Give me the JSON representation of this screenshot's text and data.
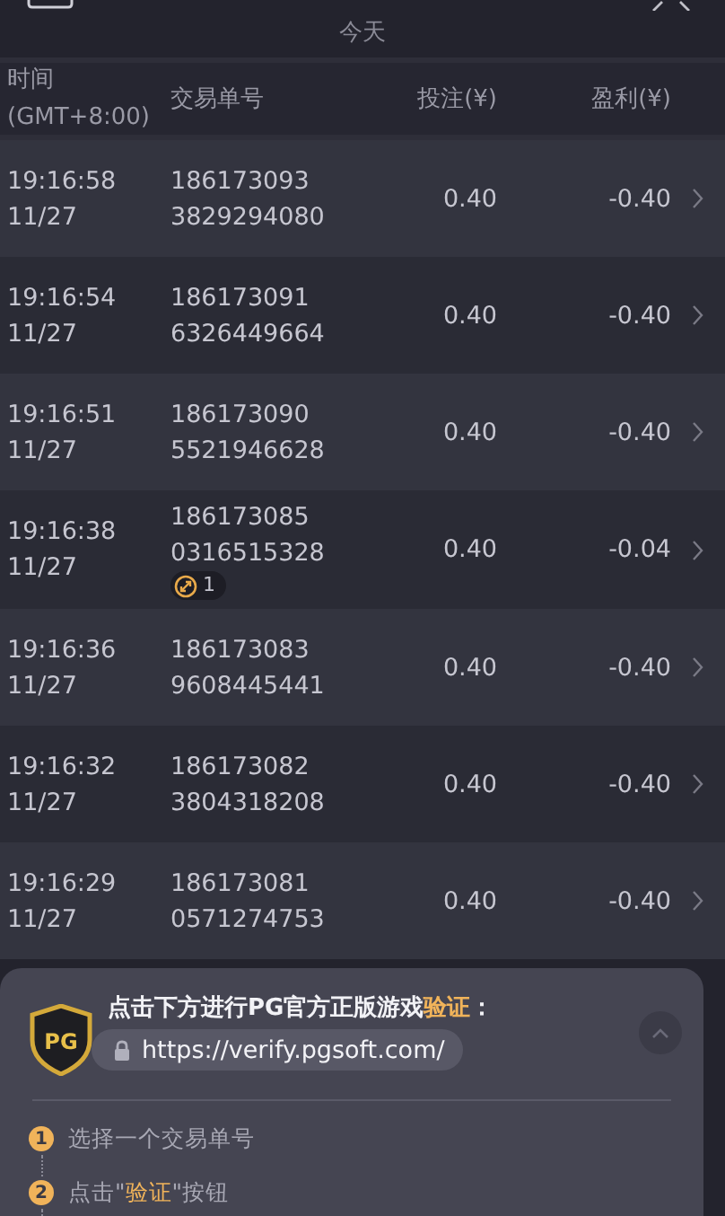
{
  "header": {
    "title": "今天"
  },
  "columns": [
    "时间",
    "(GMT+8:00)",
    "交易单号",
    "投注(¥)",
    "盈利(¥)"
  ],
  "rows": [
    {
      "time": "19:16:58",
      "date": "11/27",
      "order": [
        "186173093",
        "3829294080"
      ],
      "bet": "0.40",
      "profit": "-0.40"
    },
    {
      "time": "19:16:54",
      "date": "11/27",
      "order": [
        "186173091",
        "6326449664"
      ],
      "bet": "0.40",
      "profit": "-0.40"
    },
    {
      "time": "19:16:51",
      "date": "11/27",
      "order": [
        "186173090",
        "5521946628"
      ],
      "bet": "0.40",
      "profit": "-0.40"
    },
    {
      "time": "19:16:38",
      "date": "11/27",
      "order": [
        "186173085",
        "0316515328"
      ],
      "badge": "1",
      "bet": "0.40",
      "profit": "-0.04"
    },
    {
      "time": "19:16:36",
      "date": "11/27",
      "order": [
        "186173083",
        "9608445441"
      ],
      "bet": "0.40",
      "profit": "-0.40"
    },
    {
      "time": "19:16:32",
      "date": "11/27",
      "order": [
        "186173082",
        "3804318208"
      ],
      "bet": "0.40",
      "profit": "-0.40"
    },
    {
      "time": "19:16:29",
      "date": "11/27",
      "order": [
        "186173081",
        "0571274753"
      ],
      "bet": "0.40",
      "profit": "-0.40"
    }
  ],
  "verify": {
    "logo": "PG",
    "title": [
      {
        "text": "点击下方进行PG官方正版游戏",
        "highlight": false
      },
      {
        "text": "验证",
        "highlight": true
      },
      {
        "text": "：",
        "highlight": false
      }
    ],
    "url": "https://verify.pgsoft.com/",
    "steps": [
      {
        "number": "1",
        "parts": [
          {
            "text": "选择一个交易单号",
            "highlight": false
          }
        ]
      },
      {
        "number": "2",
        "parts": [
          {
            "text": "点击\"",
            "highlight": false
          },
          {
            "text": "验证",
            "highlight": true
          },
          {
            "text": "\"按钮",
            "highlight": false
          }
        ]
      }
    ]
  }
}
